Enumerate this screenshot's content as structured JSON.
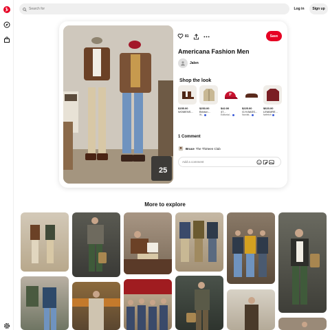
{
  "header": {
    "search_placeholder": "Search for",
    "login_label": "Log in",
    "signup_label": "Sign up"
  },
  "sidebar": {
    "icons": [
      "pinterest-logo-icon",
      "explore-icon",
      "shop-icon",
      "settings-icon"
    ],
    "brand_color": "#e60023"
  },
  "pin": {
    "save_count": "81",
    "save_label": "Save",
    "title": "Americana Fashion Men",
    "author": "Jalen",
    "image_badge": "25",
    "shop_title": "Shop the look",
    "products": [
      {
        "price": "$155.00",
        "name": "WOMENS...",
        "shop": "",
        "icon": "boots-icon"
      },
      {
        "price": "$253.00",
        "name": "Brixton...",
        "shop": "W...",
        "icon": "jacket-icon"
      },
      {
        "price": "$42.00",
        "name": "47...",
        "shop": "Editorial...",
        "icon": "cap-icon"
      },
      {
        "price": "$225.00",
        "name": "G.H.BASS...",
        "shop": "Nordst...",
        "icon": "loafer-icon"
      },
      {
        "price": "$623.00",
        "name": "LEMAIRE...",
        "shop": "farfetch",
        "icon": "sweater-icon"
      }
    ],
    "comments_title": "1 Comment",
    "comment": {
      "user": "Bruce",
      "text": "The Thirteen Club"
    },
    "comment_placeholder": "Add a comment"
  },
  "more_title": "More to explore",
  "colors": {
    "accent": "#e60023",
    "verified": "#3b5bd9"
  }
}
